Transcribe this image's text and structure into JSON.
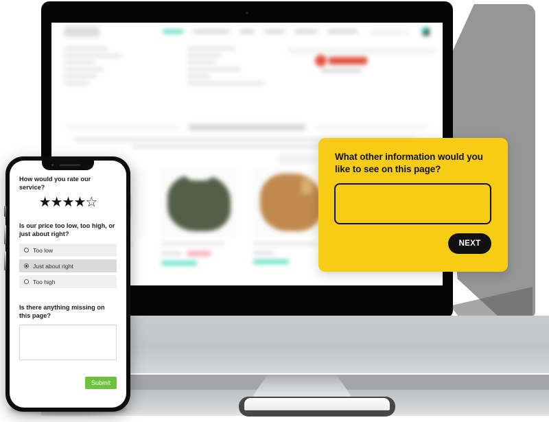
{
  "survey_desktop": {
    "question": "What other information would you like to see on this page?",
    "answer_value": "",
    "answer_placeholder": "",
    "next_label": "NEXT",
    "accent_color": "#F7CC15",
    "button_color": "#111111"
  },
  "survey_mobile": {
    "rating_question": "How would you rate our service?",
    "rating_value": 4,
    "rating_max": 5,
    "star_filled": "★",
    "star_empty": "☆",
    "price_question": "Is our price too low, too high, or just about right?",
    "price_options": [
      {
        "label": "Too low",
        "selected": false
      },
      {
        "label": "Just about right",
        "selected": true
      },
      {
        "label": "Too high",
        "selected": false
      }
    ],
    "missing_question": "Is there anything missing on this page?",
    "missing_value": "",
    "missing_placeholder": "",
    "submit_label": "Submit",
    "submit_color": "#6ec13f"
  },
  "website": {
    "logo_text": "UNITY",
    "nav_items": [
      {
        "label": "",
        "active": true,
        "w": 30
      },
      {
        "label": "",
        "active": false,
        "w": 54
      },
      {
        "label": "",
        "active": false,
        "w": 22
      },
      {
        "label": "",
        "active": false,
        "w": 30
      },
      {
        "label": "",
        "active": false,
        "w": 34
      },
      {
        "label": "",
        "active": false,
        "w": 44
      }
    ],
    "search_placeholder": "",
    "cart_icon": "cart-icon",
    "brand_logo": "veolia-logo",
    "left_list_widths": [
      64,
      84,
      46,
      58,
      48,
      36
    ],
    "right_list_widths": [
      70,
      50,
      42,
      78,
      34,
      112
    ],
    "section_title": "",
    "paragraph_widths": [
      500,
      330
    ],
    "products": [
      {
        "title": "",
        "price": "",
        "sale": true,
        "tag": ""
      },
      {
        "title": "",
        "price": "",
        "sale": true,
        "tag": ""
      },
      {
        "title": "",
        "price": "",
        "sale": false,
        "tag": ""
      }
    ]
  },
  "devices": {
    "monitor_label": "desktop-monitor",
    "phone_label": "mobile-phone"
  }
}
